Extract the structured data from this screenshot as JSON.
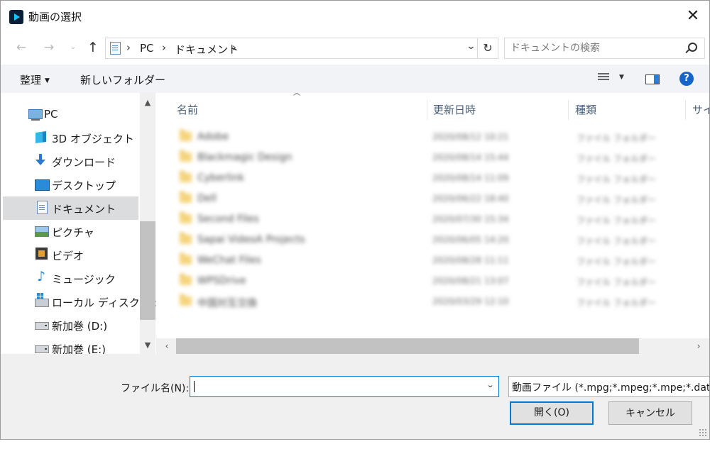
{
  "window": {
    "title": "動画の選択",
    "close_label": "✕"
  },
  "address": {
    "crumbs": [
      "PC",
      "ドキュメント"
    ],
    "search_placeholder": "ドキュメントの検索"
  },
  "toolbar": {
    "organize": "整理",
    "new_folder": "新しいフォルダー",
    "help": "?"
  },
  "navigation": {
    "items": [
      {
        "label": "PC",
        "icon": "pc-icon"
      },
      {
        "label": "3D オブジェクト",
        "icon": "3d-objects-icon"
      },
      {
        "label": "ダウンロード",
        "icon": "download-icon"
      },
      {
        "label": "デスクトップ",
        "icon": "desktop-icon"
      },
      {
        "label": "ドキュメント",
        "icon": "documents-icon",
        "selected": true
      },
      {
        "label": "ピクチャ",
        "icon": "pictures-icon"
      },
      {
        "label": "ビデオ",
        "icon": "videos-icon"
      },
      {
        "label": "ミュージック",
        "icon": "music-icon"
      },
      {
        "label": "ローカル ディスク (C:",
        "icon": "local-disk-icon"
      },
      {
        "label": "新加巻 (D:)",
        "icon": "drive-icon"
      },
      {
        "label": "新加巻 (E:)",
        "icon": "drive-icon"
      }
    ]
  },
  "filelist": {
    "columns": [
      "名前",
      "更新日時",
      "種類",
      "サイ"
    ],
    "rows": [
      {
        "name": "Adobe",
        "date": "2020/08/12 10:21",
        "type": "ファイル フォルダー"
      },
      {
        "name": "Blackmagic Design",
        "date": "2020/08/14 15:44",
        "type": "ファイル フォルダー"
      },
      {
        "name": "Cyberlink",
        "date": "2020/08/14 11:09",
        "type": "ファイル フォルダー"
      },
      {
        "name": "Dell",
        "date": "2020/06/22 18:40",
        "type": "ファイル フォルダー"
      },
      {
        "name": "Second Files",
        "date": "2020/07/30 15:34",
        "type": "ファイル フォルダー"
      },
      {
        "name": "Sapai VideoA Projects",
        "date": "2020/06/05 14:20",
        "type": "ファイル フォルダー"
      },
      {
        "name": "WeChat Files",
        "date": "2020/08/28 11:11",
        "type": "ファイル フォルダー"
      },
      {
        "name": "WPSDrive",
        "date": "2020/08/21 13:07",
        "type": "ファイル フォルダー"
      },
      {
        "name": "中国対互交換",
        "date": "2020/03/29 12:10",
        "type": "ファイル フォルダー"
      }
    ]
  },
  "bottom": {
    "filename_label": "ファイル名(N):",
    "filename_value": "",
    "filetype": "動画ファイル (*.mpg;*.mpeg;*.mpe;*.dat;",
    "open_button": "開く(O)",
    "cancel_button": "キャンセル"
  },
  "colors": {
    "accent": "#0078d7",
    "help": "#1565c8",
    "selected": "#dadcde",
    "header_text": "#4c607a"
  }
}
